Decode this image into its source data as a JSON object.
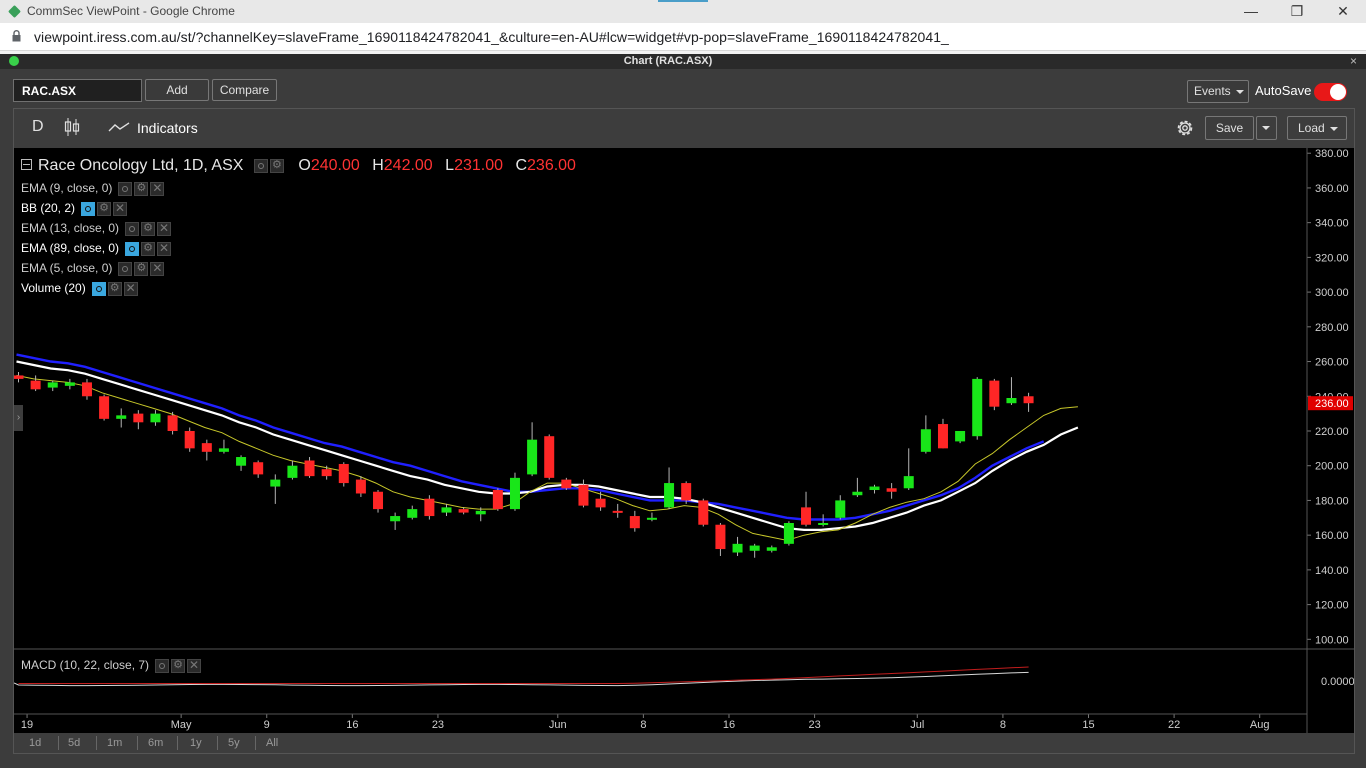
{
  "browser": {
    "tab_title": "CommSec ViewPoint - Google Chrome",
    "url": "viewpoint.iress.com.au/st/?channelKey=slaveFrame_1690118424782041_&culture=en-AU#lcw=widget#vp-pop=slaveFrame_1690118424782041_",
    "minimize_icon": "minimize-icon",
    "restore_icon": "restore-icon",
    "close_icon": "close-icon"
  },
  "widget": {
    "title": "Chart (RAC.ASX)",
    "close_label": "×"
  },
  "controls": {
    "symbol": "RAC.ASX",
    "add_label": "Add",
    "compare_label": "Compare",
    "events_label": "Events",
    "autosave_label": "AutoSave",
    "autosave_on": true
  },
  "toolbar": {
    "interval": "D",
    "indicators_label": "Indicators",
    "save_label": "Save",
    "load_label": "Load"
  },
  "legend": {
    "title": "Race Oncology Ltd, 1D, ASX",
    "o_label": "O",
    "o_value": "240.00",
    "h_label": "H",
    "h_value": "242.00",
    "l_label": "L",
    "l_value": "231.00",
    "c_label": "C",
    "c_value": "236.00"
  },
  "indicators": [
    {
      "label": "EMA (9, close, 0)",
      "visible": false
    },
    {
      "label": "BB (20, 2)",
      "visible": true
    },
    {
      "label": "EMA (13, close, 0)",
      "visible": false
    },
    {
      "label": "EMA (89, close, 0)",
      "visible": true
    },
    {
      "label": "EMA (5, close, 0)",
      "visible": false
    },
    {
      "label": "Volume (20)",
      "visible": true
    }
  ],
  "macd": {
    "label": "MACD (10, 22, close, 7)",
    "zero_label": "0.0000"
  },
  "ranges": [
    "1d",
    "5d",
    "1m",
    "6m",
    "1y",
    "5y",
    "All"
  ],
  "chart_data": {
    "type": "candlestick",
    "title": "Race Oncology Ltd, 1D, ASX",
    "ylim": [
      95,
      383
    ],
    "y_ticks": [
      "380.00",
      "360.00",
      "340.00",
      "320.00",
      "300.00",
      "280.00",
      "260.00",
      "240.00",
      "220.00",
      "200.00",
      "180.00",
      "160.00",
      "140.00",
      "120.00",
      "100.00"
    ],
    "y_tick_values": [
      380,
      360,
      340,
      320,
      300,
      280,
      260,
      240,
      220,
      200,
      180,
      160,
      140,
      120,
      100
    ],
    "last_price": "236.00",
    "last_price_value": 236,
    "x_ticks": [
      "19",
      "May",
      "9",
      "16",
      "23",
      "Jun",
      "8",
      "16",
      "23",
      "Jul",
      "8",
      "15",
      "22",
      "Aug"
    ],
    "x_tick_index": [
      0.5,
      9.5,
      14.5,
      19.5,
      24.5,
      31.5,
      36.5,
      41.5,
      46.5,
      52.5,
      57.5,
      62.5,
      67.5,
      72.5
    ],
    "candles": [
      {
        "o": 252,
        "h": 254,
        "l": 248,
        "c": 250
      },
      {
        "o": 249,
        "h": 252,
        "l": 243,
        "c": 244
      },
      {
        "o": 245,
        "h": 249,
        "l": 243,
        "c": 248
      },
      {
        "o": 246,
        "h": 250,
        "l": 244,
        "c": 248
      },
      {
        "o": 248,
        "h": 250,
        "l": 238,
        "c": 240
      },
      {
        "o": 240,
        "h": 241,
        "l": 226,
        "c": 227
      },
      {
        "o": 227,
        "h": 233,
        "l": 222,
        "c": 229
      },
      {
        "o": 230,
        "h": 232,
        "l": 221,
        "c": 225
      },
      {
        "o": 225,
        "h": 232,
        "l": 223,
        "c": 230
      },
      {
        "o": 229,
        "h": 231,
        "l": 218,
        "c": 220
      },
      {
        "o": 220,
        "h": 222,
        "l": 208,
        "c": 210
      },
      {
        "o": 213,
        "h": 215,
        "l": 203,
        "c": 208
      },
      {
        "o": 208,
        "h": 215,
        "l": 207,
        "c": 210
      },
      {
        "o": 200,
        "h": 206,
        "l": 197,
        "c": 205
      },
      {
        "o": 202,
        "h": 203,
        "l": 193,
        "c": 195
      },
      {
        "o": 188,
        "h": 195,
        "l": 178,
        "c": 192
      },
      {
        "o": 193,
        "h": 203,
        "l": 192,
        "c": 200
      },
      {
        "o": 203,
        "h": 205,
        "l": 193,
        "c": 194
      },
      {
        "o": 198,
        "h": 200,
        "l": 192,
        "c": 194
      },
      {
        "o": 201,
        "h": 202,
        "l": 188,
        "c": 190
      },
      {
        "o": 192,
        "h": 194,
        "l": 182,
        "c": 184
      },
      {
        "o": 185,
        "h": 186,
        "l": 173,
        "c": 175
      },
      {
        "o": 168,
        "h": 173,
        "l": 163,
        "c": 171
      },
      {
        "o": 170,
        "h": 177,
        "l": 169,
        "c": 175
      },
      {
        "o": 181,
        "h": 183,
        "l": 169,
        "c": 171
      },
      {
        "o": 173,
        "h": 178,
        "l": 171,
        "c": 176
      },
      {
        "o": 175,
        "h": 176,
        "l": 172,
        "c": 173
      },
      {
        "o": 172,
        "h": 176,
        "l": 168,
        "c": 174
      },
      {
        "o": 186,
        "h": 187,
        "l": 174,
        "c": 175
      },
      {
        "o": 175,
        "h": 196,
        "l": 174,
        "c": 193
      },
      {
        "o": 195,
        "h": 225,
        "l": 194,
        "c": 215
      },
      {
        "o": 217,
        "h": 218,
        "l": 192,
        "c": 193
      },
      {
        "o": 192,
        "h": 193,
        "l": 186,
        "c": 187
      },
      {
        "o": 189,
        "h": 192,
        "l": 176,
        "c": 177
      },
      {
        "o": 181,
        "h": 185,
        "l": 174,
        "c": 176
      },
      {
        "o": 174,
        "h": 178,
        "l": 170,
        "c": 173
      },
      {
        "o": 171,
        "h": 174,
        "l": 162,
        "c": 164
      },
      {
        "o": 169,
        "h": 173,
        "l": 168,
        "c": 170
      },
      {
        "o": 176,
        "h": 199,
        "l": 175,
        "c": 190
      },
      {
        "o": 190,
        "h": 191,
        "l": 178,
        "c": 180
      },
      {
        "o": 180,
        "h": 181,
        "l": 165,
        "c": 166
      },
      {
        "o": 166,
        "h": 167,
        "l": 148,
        "c": 152
      },
      {
        "o": 150,
        "h": 159,
        "l": 148,
        "c": 155
      },
      {
        "o": 151,
        "h": 155,
        "l": 147,
        "c": 154
      },
      {
        "o": 151,
        "h": 154,
        "l": 150,
        "c": 153
      },
      {
        "o": 155,
        "h": 168,
        "l": 154,
        "c": 167
      },
      {
        "o": 176,
        "h": 185,
        "l": 165,
        "c": 166
      },
      {
        "o": 166,
        "h": 172,
        "l": 165,
        "c": 167
      },
      {
        "o": 170,
        "h": 183,
        "l": 169,
        "c": 180
      },
      {
        "o": 183,
        "h": 193,
        "l": 182,
        "c": 185
      },
      {
        "o": 186,
        "h": 189,
        "l": 184,
        "c": 188
      },
      {
        "o": 187,
        "h": 190,
        "l": 181,
        "c": 185
      },
      {
        "o": 187,
        "h": 210,
        "l": 186,
        "c": 194
      },
      {
        "o": 208,
        "h": 229,
        "l": 207,
        "c": 221
      },
      {
        "o": 224,
        "h": 227,
        "l": 210,
        "c": 210
      },
      {
        "o": 214,
        "h": 220,
        "l": 213,
        "c": 220
      },
      {
        "o": 217,
        "h": 251,
        "l": 215,
        "c": 250
      },
      {
        "o": 249,
        "h": 250,
        "l": 232,
        "c": 234
      },
      {
        "o": 236,
        "h": 251,
        "l": 235,
        "c": 239
      },
      {
        "o": 240,
        "h": 242,
        "l": 231,
        "c": 236
      }
    ],
    "series": [
      {
        "name": "EMA (89, close, 0)",
        "color": "#2020ff",
        "values": [
          264,
          262,
          260,
          259,
          257,
          254,
          251,
          248,
          245,
          242,
          239,
          236,
          233,
          229,
          226,
          222,
          219,
          216,
          213,
          211,
          208,
          205,
          202,
          200,
          197,
          194,
          191,
          189,
          187,
          185,
          185,
          186,
          187,
          187,
          186,
          184,
          182,
          180,
          180,
          180,
          179,
          178,
          176,
          174,
          172,
          170,
          169,
          169,
          169,
          170,
          172,
          174,
          177,
          180,
          183,
          187,
          193,
          200,
          205,
          210,
          214
        ]
      },
      {
        "name": "EMA (13, close, 0)",
        "color": "#ffffff",
        "values": [
          260,
          258,
          256,
          255,
          253,
          250,
          247,
          244,
          241,
          238,
          235,
          232,
          229,
          225,
          222,
          218,
          215,
          212,
          209,
          206,
          203,
          200,
          197,
          194,
          192,
          189,
          187,
          185,
          184,
          184,
          185,
          188,
          189,
          189,
          188,
          186,
          184,
          182,
          182,
          181,
          179,
          176,
          173,
          170,
          167,
          164,
          163,
          163,
          164,
          165,
          167,
          170,
          173,
          177,
          180,
          185,
          190,
          197,
          203,
          208,
          212,
          218,
          222
        ]
      },
      {
        "name": "EMA (5, close, 0)",
        "color": "#c7c72a",
        "values": [
          252,
          250,
          249,
          248,
          246,
          242,
          239,
          236,
          233,
          230,
          226,
          222,
          219,
          214,
          210,
          206,
          203,
          201,
          199,
          197,
          194,
          190,
          185,
          182,
          180,
          178,
          176,
          175,
          175,
          178,
          185,
          190,
          190,
          187,
          184,
          181,
          177,
          174,
          175,
          177,
          176,
          172,
          166,
          161,
          159,
          157,
          160,
          162,
          163,
          167,
          172,
          176,
          179,
          181,
          185,
          191,
          201,
          207,
          215,
          222,
          229,
          233,
          234
        ]
      }
    ],
    "macd": {
      "ylim": [
        -0.05,
        0.05
      ],
      "zero": 0
    },
    "colors": {
      "up": "#19e619",
      "down": "#ff2626",
      "last_price_bg": "#e00000",
      "axis_text": "#cfcfcf"
    }
  }
}
